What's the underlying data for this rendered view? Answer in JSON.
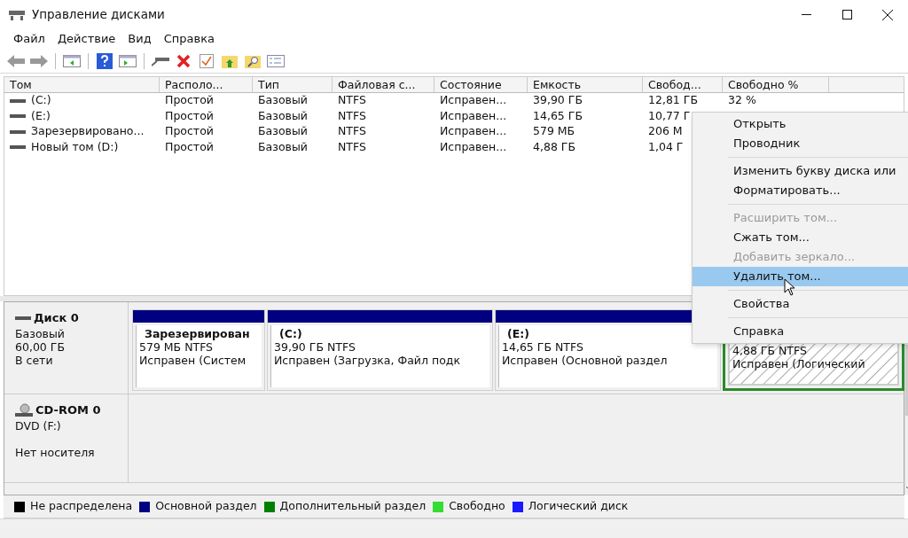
{
  "window": {
    "title": "Управление дисками"
  },
  "menu": [
    "Файл",
    "Действие",
    "Вид",
    "Справка"
  ],
  "table": {
    "columns": [
      "Том",
      "Располо...",
      "Тип",
      "Файловая с...",
      "Состояние",
      "Емкость",
      "Свобод...",
      "Свободно %"
    ],
    "rows": [
      {
        "cells": [
          "(C:)",
          "Простой",
          "Базовый",
          "NTFS",
          "Исправен...",
          "39,90 ГБ",
          "12,81 ГБ",
          "32 %"
        ]
      },
      {
        "cells": [
          "(E:)",
          "Простой",
          "Базовый",
          "NTFS",
          "Исправен...",
          "14,65 ГБ",
          "10,77 Г"
        ]
      },
      {
        "cells": [
          "Зарезервировано...",
          "Простой",
          "Базовый",
          "NTFS",
          "Исправен...",
          "579 МБ",
          "206 М"
        ]
      },
      {
        "cells": [
          "Новый том (D:)",
          "Простой",
          "Базовый",
          "NTFS",
          "Исправен...",
          "4,88 ГБ",
          "1,04 Г"
        ]
      }
    ]
  },
  "disks": [
    {
      "kind": "hdd",
      "name": "Диск 0",
      "lines": [
        "Базовый",
        "60,00 ГБ",
        "В сети"
      ],
      "partitions": [
        {
          "kind": "primary",
          "name": "Зарезервирован",
          "size": "579 МБ NTFS",
          "status": "Исправен (Систем",
          "selected": false
        },
        {
          "kind": "primary",
          "name": "(C:)",
          "size": "39,90 ГБ NTFS",
          "status": "Исправен (Загрузка, Файл подк",
          "selected": false
        },
        {
          "kind": "primary",
          "name": "(E:)",
          "size": "14,65 ГБ NTFS",
          "status": "Исправен (Основной раздел",
          "selected": false
        },
        {
          "kind": "logical",
          "size": "4,88 ГБ NTFS",
          "status": "Исправен (Логический",
          "selected": true
        }
      ]
    },
    {
      "kind": "cdrom",
      "name": "CD-ROM 0",
      "lines": [
        "DVD (F:)"
      ],
      "status": "Нет носителя"
    }
  ],
  "legend": [
    {
      "label": "Не распределена",
      "color": "#000000"
    },
    {
      "label": "Основной раздел",
      "color": "#000080"
    },
    {
      "label": "Дополнительный раздел",
      "color": "#008000"
    },
    {
      "label": "Свободно",
      "color": "#33dd33"
    },
    {
      "label": "Логический диск",
      "color": "#1a1aff"
    }
  ],
  "context_menu": [
    {
      "kind": "item",
      "label": "Открыть",
      "disabled": false,
      "selected": false
    },
    {
      "kind": "item",
      "label": "Проводник",
      "disabled": false,
      "selected": false
    },
    {
      "kind": "separator"
    },
    {
      "kind": "item",
      "label": "Изменить букву диска или",
      "disabled": false,
      "selected": false
    },
    {
      "kind": "item",
      "label": "Форматировать...",
      "disabled": false,
      "selected": false
    },
    {
      "kind": "separator"
    },
    {
      "kind": "item",
      "label": "Расширить том...",
      "disabled": true,
      "selected": false
    },
    {
      "kind": "item",
      "label": "Сжать том...",
      "disabled": false,
      "selected": false
    },
    {
      "kind": "item",
      "label": "Добавить зеркало...",
      "disabled": true,
      "selected": false
    },
    {
      "kind": "item",
      "label": "Удалить том...",
      "disabled": false,
      "selected": true
    },
    {
      "kind": "separator"
    },
    {
      "kind": "item",
      "label": "Свойства",
      "disabled": false,
      "selected": false
    },
    {
      "kind": "separator"
    },
    {
      "kind": "item",
      "label": "Справка",
      "disabled": false,
      "selected": false
    }
  ]
}
